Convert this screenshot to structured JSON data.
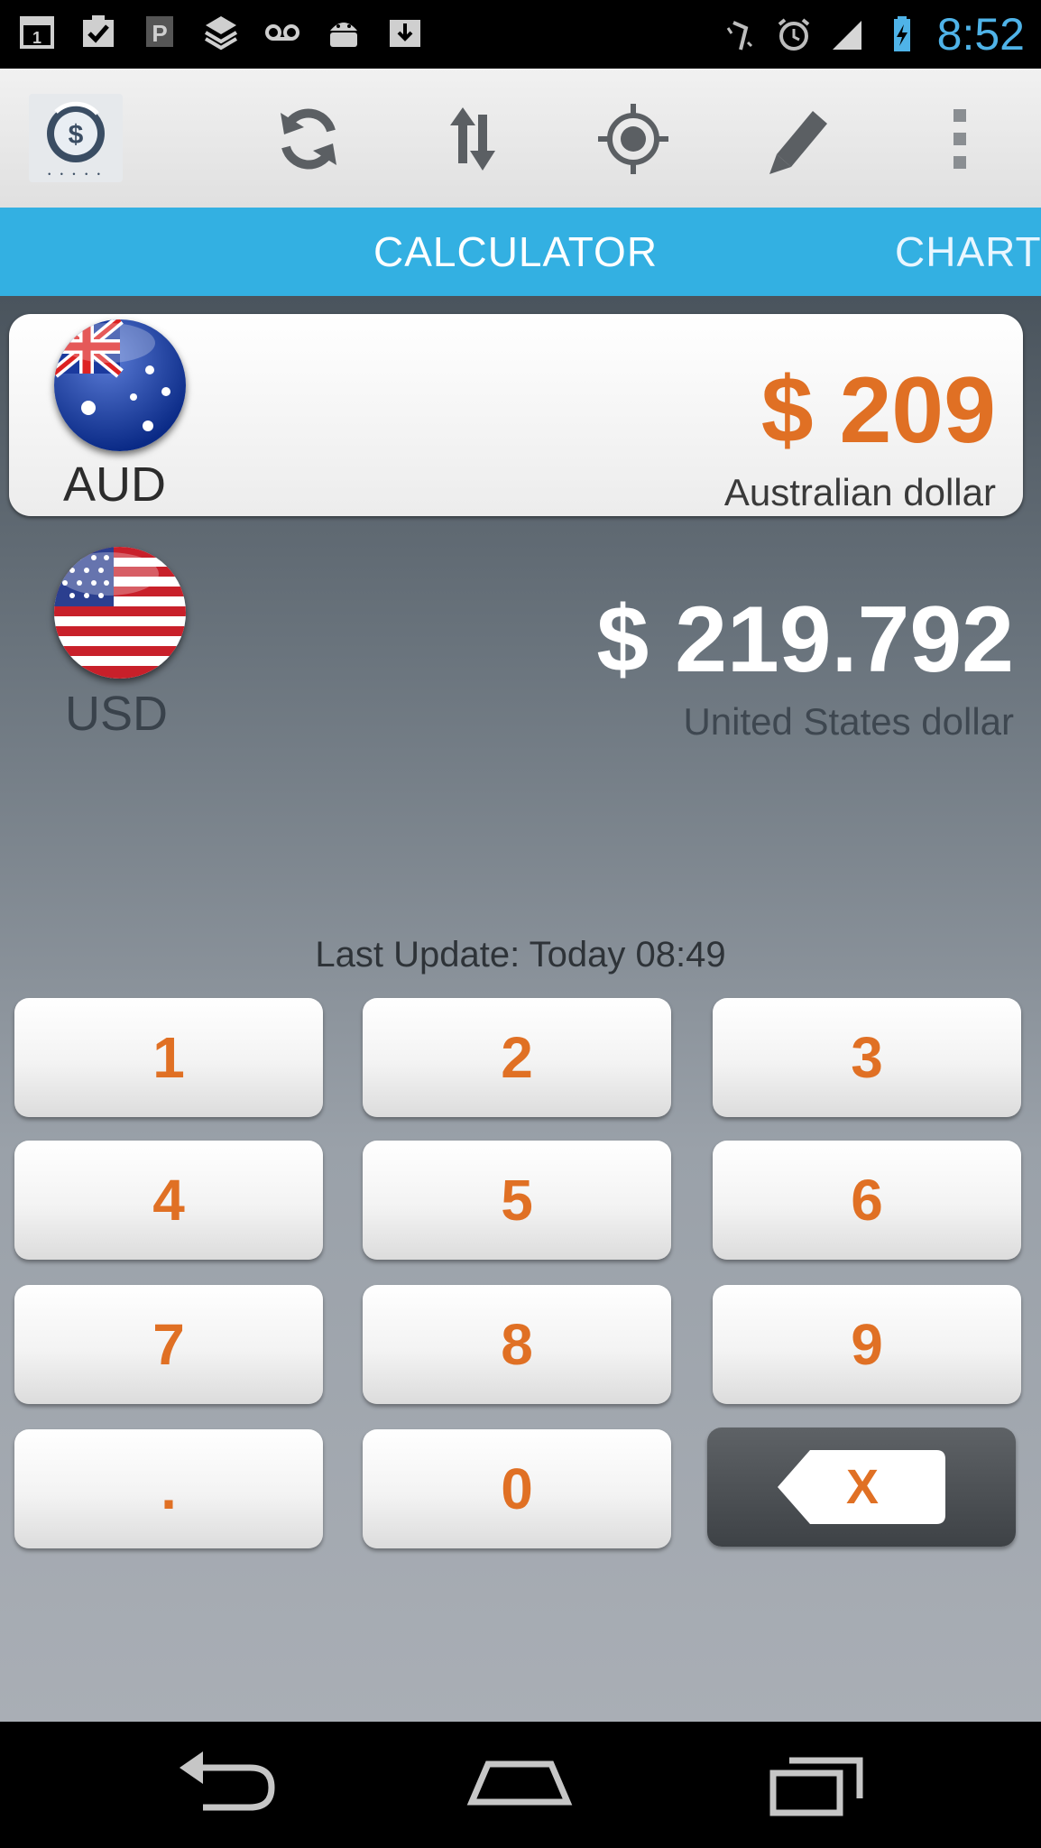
{
  "status_bar": {
    "time": "8:52"
  },
  "action_bar": {
    "app_logo": "currency-converter-logo",
    "actions": [
      "refresh-icon",
      "swap-icon",
      "locate-icon",
      "edit-icon",
      "overflow-menu-icon"
    ]
  },
  "tabs": {
    "calculator": "CALCULATOR",
    "chart": "CHART"
  },
  "converter": {
    "from": {
      "code": "AUD",
      "amount": "$ 209",
      "name": "Australian dollar"
    },
    "to": {
      "code": "USD",
      "amount": "$ 219.792",
      "name": "United States dollar"
    },
    "last_update": "Last Update: Today 08:49"
  },
  "keypad": {
    "keys": [
      "1",
      "2",
      "3",
      "4",
      "5",
      "6",
      "7",
      "8",
      "9",
      ".",
      "0"
    ],
    "delete_label": "X"
  },
  "colors": {
    "accent_blue": "#33b0e2",
    "orange": "#e07024",
    "time_blue": "#4fb3e8"
  }
}
